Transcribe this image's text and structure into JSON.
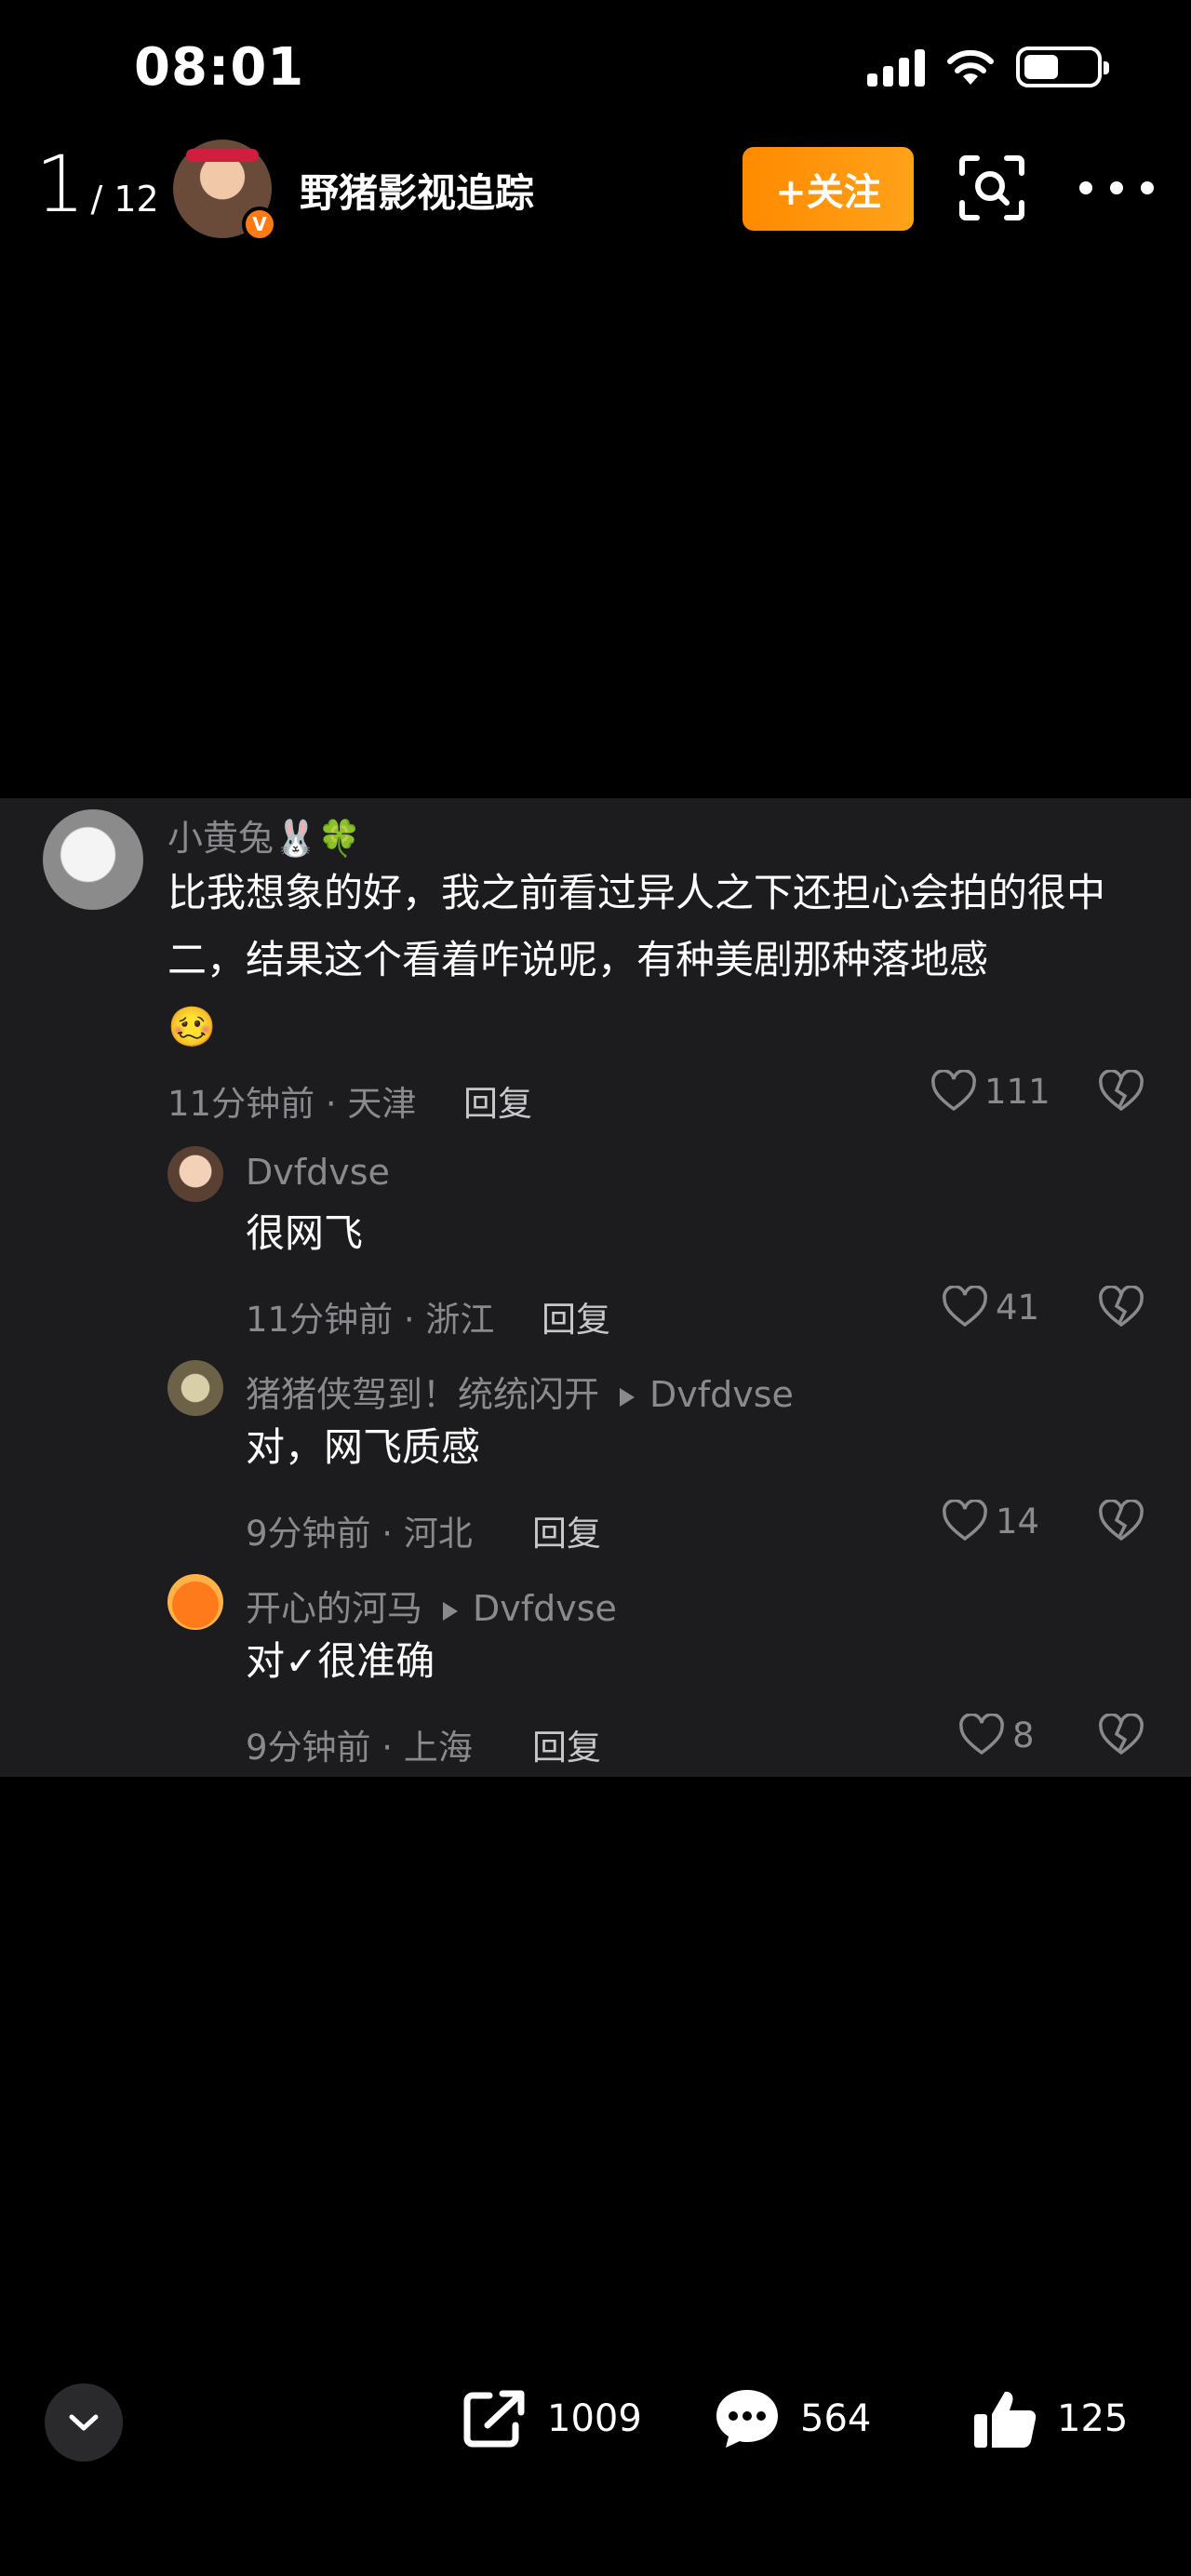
{
  "status_bar": {
    "time": "08:01"
  },
  "header": {
    "page_current": "1",
    "page_total": "/ 12",
    "author_name": "野猪影视追踪",
    "verified_mark": "V",
    "follow_label": "+关注"
  },
  "comments": [
    {
      "username": "小黄兔🐰🍀",
      "text": "比我想象的好，我之前看过异人之下还担心会拍的很中二，结果这个看着咋说呢，有种美剧那种落地感",
      "emoji": "🥴",
      "meta": "11分钟前 · 天津",
      "reply_label": "回复",
      "likes": "111"
    },
    {
      "username": "Dvfdvse",
      "text": "很网飞",
      "meta": "11分钟前 · 浙江",
      "reply_label": "回复",
      "likes": "41"
    },
    {
      "username": "猪猪侠驾到！统统闪开",
      "reply_to": "Dvfdvse",
      "text": "对，网飞质感",
      "meta": "9分钟前 · 河北",
      "reply_label": "回复",
      "likes": "14"
    },
    {
      "username": "开心的河马",
      "reply_to": "Dvfdvse",
      "text": "对✓很准确",
      "meta": "9分钟前 · 上海",
      "reply_label": "回复",
      "likes": "8"
    }
  ],
  "toolbar": {
    "share_count": "1009",
    "comment_count": "564",
    "like_count": "125"
  },
  "colors": {
    "accent": "#ff8a00",
    "panel": "#1c1c1e",
    "muted": "#8a8a8e"
  },
  "icons": [
    "signal-icon",
    "wifi-icon",
    "battery-icon",
    "scan-icon",
    "more-icon",
    "heart-icon",
    "broken-heart-icon",
    "share-icon",
    "comment-icon",
    "thumbs-up-icon",
    "chevron-down-icon"
  ]
}
